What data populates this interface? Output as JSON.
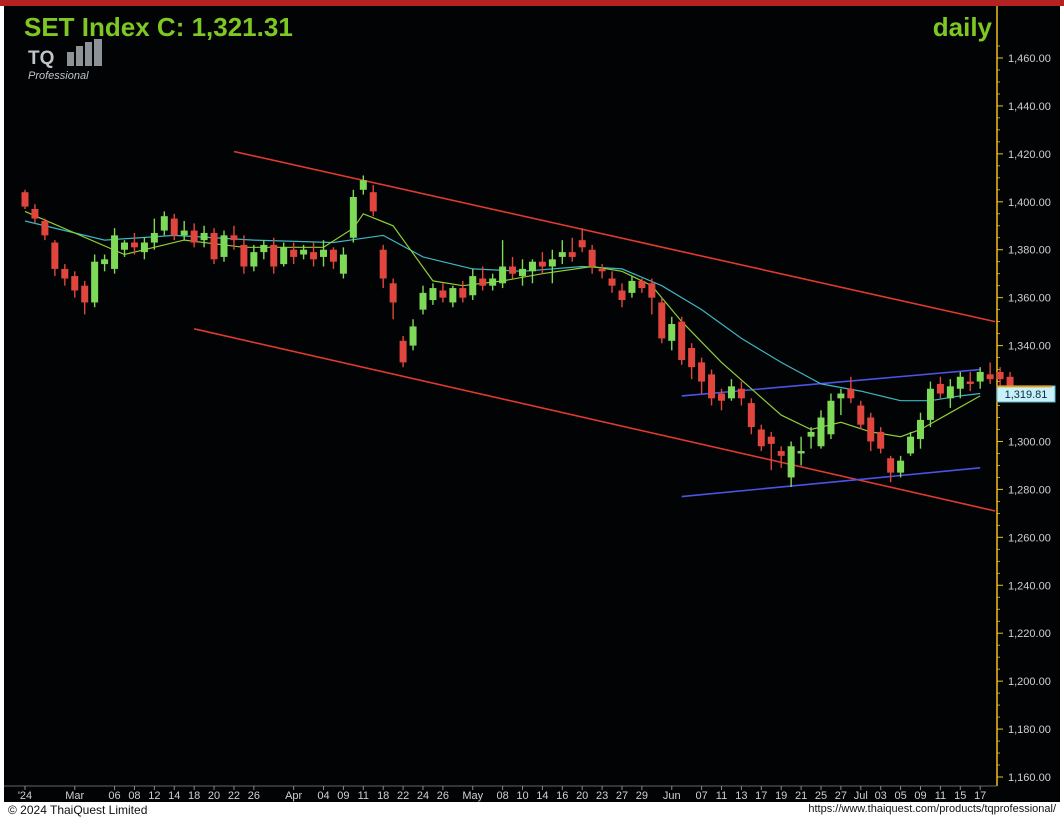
{
  "header": {
    "title": "SET Index C: 1,321.31",
    "period": "daily",
    "logo_text": "TQ",
    "logo_subtext": "Professional"
  },
  "footer": {
    "copyright": "© 2024  ThaiQuest Limited",
    "url": "https://www.thaiquest.com/products/tqprofessional/"
  },
  "colors": {
    "background": "#020305",
    "title": "#7ec824",
    "up_candle": "#7ed958",
    "down_candle": "#e0463d",
    "ma_fast": "#8fce35",
    "ma_slow": "#3db7c4",
    "trend_red": "#e03a2e",
    "trend_blue": "#4a55e6",
    "axis_text": "#d0d0d0",
    "last_price_bg": "#c8f0f8"
  },
  "chart_data": {
    "type": "candlestick",
    "title": "SET Index C: 1,321.31",
    "period": "daily",
    "ylim": [
      1155,
      1470
    ],
    "y_ticks": [
      "1,460.00",
      "1,440.00",
      "1,420.00",
      "1,400.00",
      "1,380.00",
      "1,360.00",
      "1,340.00",
      "1,320.00",
      "1,300.00",
      "1,280.00",
      "1,260.00",
      "1,240.00",
      "1,220.00",
      "1,200.00",
      "1,180.00",
      "1,160.00"
    ],
    "last_price_label": "1,319.81",
    "x_ticks": [
      {
        "label": "'24",
        "i": 0
      },
      {
        "label": "Mar",
        "i": 5
      },
      {
        "label": "06",
        "i": 9
      },
      {
        "label": "08",
        "i": 11
      },
      {
        "label": "12",
        "i": 13
      },
      {
        "label": "14",
        "i": 15
      },
      {
        "label": "18",
        "i": 17
      },
      {
        "label": "20",
        "i": 19
      },
      {
        "label": "22",
        "i": 21
      },
      {
        "label": "26",
        "i": 23
      },
      {
        "label": "Apr",
        "i": 27
      },
      {
        "label": "04",
        "i": 30
      },
      {
        "label": "09",
        "i": 32
      },
      {
        "label": "11",
        "i": 34
      },
      {
        "label": "18",
        "i": 36
      },
      {
        "label": "22",
        "i": 38
      },
      {
        "label": "24",
        "i": 40
      },
      {
        "label": "26",
        "i": 42
      },
      {
        "label": "May",
        "i": 45
      },
      {
        "label": "08",
        "i": 48
      },
      {
        "label": "10",
        "i": 50
      },
      {
        "label": "14",
        "i": 52
      },
      {
        "label": "16",
        "i": 54
      },
      {
        "label": "20",
        "i": 56
      },
      {
        "label": "23",
        "i": 58
      },
      {
        "label": "27",
        "i": 60
      },
      {
        "label": "29",
        "i": 62
      },
      {
        "label": "Jun",
        "i": 65
      },
      {
        "label": "07",
        "i": 68
      },
      {
        "label": "11",
        "i": 70
      },
      {
        "label": "13",
        "i": 72
      },
      {
        "label": "17",
        "i": 74
      },
      {
        "label": "19",
        "i": 76
      },
      {
        "label": "21",
        "i": 78
      },
      {
        "label": "25",
        "i": 80
      },
      {
        "label": "27",
        "i": 82
      },
      {
        "label": "Jul",
        "i": 84
      },
      {
        "label": "03",
        "i": 86
      },
      {
        "label": "05",
        "i": 88
      },
      {
        "label": "09",
        "i": 90
      },
      {
        "label": "11",
        "i": 92
      },
      {
        "label": "15",
        "i": 94
      },
      {
        "label": "17",
        "i": 96
      }
    ],
    "candles": [
      [
        1404,
        1405,
        1397,
        1398
      ],
      [
        1397,
        1399,
        1391,
        1393
      ],
      [
        1392,
        1393,
        1384,
        1386
      ],
      [
        1383,
        1384,
        1369,
        1372
      ],
      [
        1372,
        1374,
        1365,
        1368
      ],
      [
        1369,
        1371,
        1360,
        1363
      ],
      [
        1365,
        1367,
        1353,
        1358
      ],
      [
        1358,
        1378,
        1356,
        1375
      ],
      [
        1374,
        1378,
        1371,
        1376
      ],
      [
        1372,
        1389,
        1370,
        1386
      ],
      [
        1380,
        1384,
        1377,
        1383
      ],
      [
        1383,
        1387,
        1378,
        1381
      ],
      [
        1379,
        1385,
        1376,
        1383
      ],
      [
        1383,
        1393,
        1380,
        1387
      ],
      [
        1388,
        1396,
        1386,
        1394
      ],
      [
        1393,
        1395,
        1384,
        1386
      ],
      [
        1386,
        1392,
        1384,
        1388
      ],
      [
        1388,
        1391,
        1381,
        1383
      ],
      [
        1384,
        1390,
        1381,
        1387
      ],
      [
        1387,
        1389,
        1374,
        1376
      ],
      [
        1377,
        1388,
        1375,
        1386
      ],
      [
        1386,
        1390,
        1380,
        1384
      ],
      [
        1382,
        1386,
        1370,
        1373
      ],
      [
        1373,
        1382,
        1371,
        1379
      ],
      [
        1379,
        1384,
        1376,
        1382
      ],
      [
        1382,
        1385,
        1370,
        1373
      ],
      [
        1374,
        1383,
        1373,
        1381
      ],
      [
        1380,
        1383,
        1374,
        1377
      ],
      [
        1378,
        1382,
        1376,
        1380
      ],
      [
        1379,
        1383,
        1373,
        1376
      ],
      [
        1377,
        1384,
        1373,
        1380
      ],
      [
        1380,
        1381,
        1372,
        1375
      ],
      [
        1370,
        1381,
        1368,
        1378
      ],
      [
        1385,
        1405,
        1383,
        1402
      ],
      [
        1405,
        1411,
        1403,
        1409
      ],
      [
        1404,
        1407,
        1394,
        1396
      ],
      [
        1380,
        1382,
        1364,
        1368
      ],
      [
        1366,
        1368,
        1351,
        1358
      ],
      [
        1342,
        1344,
        1331,
        1333
      ],
      [
        1340,
        1351,
        1338,
        1348
      ],
      [
        1355,
        1365,
        1353,
        1362
      ],
      [
        1359,
        1366,
        1357,
        1364
      ],
      [
        1363,
        1366,
        1358,
        1360
      ],
      [
        1358,
        1365,
        1356,
        1364
      ],
      [
        1364,
        1367,
        1358,
        1360
      ],
      [
        1361,
        1372,
        1359,
        1369
      ],
      [
        1368,
        1373,
        1363,
        1365
      ],
      [
        1365,
        1370,
        1363,
        1368
      ],
      [
        1366,
        1384,
        1364,
        1373
      ],
      [
        1373,
        1377,
        1368,
        1370
      ],
      [
        1369,
        1376,
        1365,
        1372
      ],
      [
        1371,
        1376,
        1366,
        1375
      ],
      [
        1375,
        1379,
        1370,
        1373
      ],
      [
        1373,
        1380,
        1366,
        1376
      ],
      [
        1377,
        1384,
        1374,
        1379
      ],
      [
        1379,
        1385,
        1375,
        1377
      ],
      [
        1384,
        1389,
        1379,
        1381
      ],
      [
        1380,
        1382,
        1370,
        1373
      ],
      [
        1372,
        1374,
        1368,
        1371
      ],
      [
        1368,
        1371,
        1362,
        1365
      ],
      [
        1363,
        1366,
        1356,
        1359
      ],
      [
        1362,
        1369,
        1360,
        1367
      ],
      [
        1367,
        1368,
        1362,
        1364
      ],
      [
        1366,
        1368,
        1353,
        1360
      ],
      [
        1358,
        1360,
        1341,
        1343
      ],
      [
        1342,
        1352,
        1338,
        1349
      ],
      [
        1350,
        1352,
        1332,
        1334
      ],
      [
        1339,
        1341,
        1326,
        1331
      ],
      [
        1333,
        1335,
        1320,
        1325
      ],
      [
        1328,
        1330,
        1315,
        1318
      ],
      [
        1320,
        1322,
        1313,
        1317
      ],
      [
        1318,
        1326,
        1317,
        1323
      ],
      [
        1322,
        1325,
        1315,
        1318
      ],
      [
        1316,
        1318,
        1303,
        1306
      ],
      [
        1305,
        1307,
        1296,
        1298
      ],
      [
        1302,
        1304,
        1288,
        1299
      ],
      [
        1296,
        1298,
        1289,
        1294
      ],
      [
        1285,
        1300,
        1281,
        1298
      ],
      [
        1295,
        1302,
        1290,
        1296
      ],
      [
        1302,
        1306,
        1297,
        1304
      ],
      [
        1298,
        1313,
        1297,
        1310
      ],
      [
        1303,
        1320,
        1301,
        1317
      ],
      [
        1318,
        1322,
        1311,
        1320
      ],
      [
        1322,
        1327,
        1316,
        1318
      ],
      [
        1315,
        1317,
        1305,
        1307
      ],
      [
        1310,
        1312,
        1296,
        1300
      ],
      [
        1304,
        1306,
        1295,
        1297
      ],
      [
        1293,
        1294,
        1283,
        1287
      ],
      [
        1287,
        1294,
        1285,
        1292
      ],
      [
        1295,
        1304,
        1294,
        1302
      ],
      [
        1301,
        1312,
        1297,
        1309
      ],
      [
        1309,
        1325,
        1306,
        1322
      ],
      [
        1324,
        1327,
        1318,
        1320
      ],
      [
        1318,
        1326,
        1314,
        1323
      ],
      [
        1322,
        1329,
        1318,
        1327
      ],
      [
        1325,
        1329,
        1321,
        1324
      ],
      [
        1325,
        1331,
        1322,
        1329
      ],
      [
        1328,
        1333,
        1324,
        1326
      ],
      [
        1329,
        1331,
        1322,
        1326
      ],
      [
        1327,
        1329,
        1318,
        1321
      ]
    ],
    "ma_fast": [
      [
        0,
        1396
      ],
      [
        10,
        1378
      ],
      [
        16,
        1384
      ],
      [
        22,
        1381
      ],
      [
        30,
        1381
      ],
      [
        33,
        1389
      ],
      [
        34,
        1395
      ],
      [
        37,
        1390
      ],
      [
        41,
        1367
      ],
      [
        44,
        1365
      ],
      [
        48,
        1367
      ],
      [
        52,
        1370
      ],
      [
        57,
        1373
      ],
      [
        60,
        1371
      ],
      [
        63,
        1365
      ],
      [
        66,
        1350
      ],
      [
        70,
        1333
      ],
      [
        73,
        1322
      ],
      [
        76,
        1311
      ],
      [
        79,
        1305
      ],
      [
        82,
        1308
      ],
      [
        85,
        1304
      ],
      [
        88,
        1302
      ],
      [
        90,
        1305
      ],
      [
        93,
        1312
      ],
      [
        96,
        1319
      ]
    ],
    "ma_slow": [
      [
        0,
        1392
      ],
      [
        8,
        1384
      ],
      [
        15,
        1386
      ],
      [
        23,
        1384
      ],
      [
        31,
        1383
      ],
      [
        36,
        1386
      ],
      [
        40,
        1377
      ],
      [
        45,
        1372
      ],
      [
        50,
        1371
      ],
      [
        56,
        1373
      ],
      [
        60,
        1372
      ],
      [
        64,
        1365
      ],
      [
        68,
        1355
      ],
      [
        72,
        1343
      ],
      [
        76,
        1333
      ],
      [
        80,
        1324
      ],
      [
        84,
        1321
      ],
      [
        88,
        1317
      ],
      [
        91,
        1317
      ],
      [
        94,
        1319
      ],
      [
        96,
        1320
      ]
    ],
    "trendlines": [
      {
        "color": "red",
        "from": [
          21,
          1421
        ],
        "to": [
          97.5,
          1350
        ]
      },
      {
        "color": "red",
        "from": [
          17,
          1347
        ],
        "to": [
          97.5,
          1271
        ]
      },
      {
        "color": "blue",
        "from": [
          66,
          1319
        ],
        "to": [
          96,
          1330
        ]
      },
      {
        "color": "blue",
        "from": [
          66,
          1277
        ],
        "to": [
          96,
          1289
        ]
      }
    ]
  }
}
